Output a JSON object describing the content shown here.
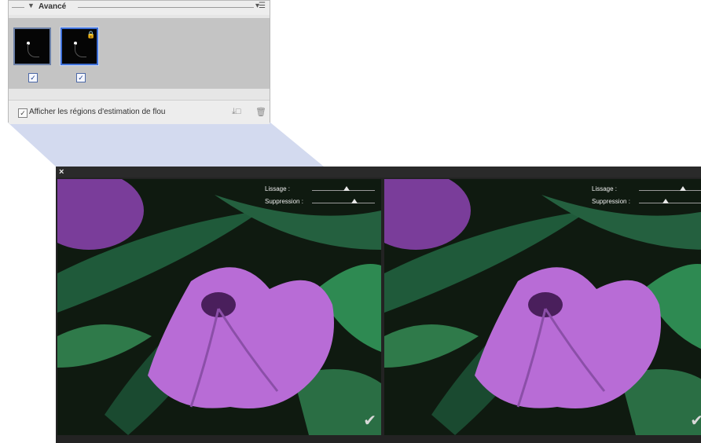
{
  "panel": {
    "title": "Avancé",
    "menu_icon": "panel-menu-icon",
    "thumbnails": [
      {
        "checked": true,
        "selected": false,
        "locked": false
      },
      {
        "checked": true,
        "selected": true,
        "locked": true
      }
    ],
    "check_glyph": "✓",
    "footer": {
      "checkbox_checked": true,
      "label": "Afficher les régions d'estimation de flou",
      "icons": [
        "add-region-icon",
        "trash-icon"
      ]
    }
  },
  "preview": {
    "close_glyph": "×",
    "panes": [
      {
        "smoothing_label": "Lissage :",
        "suppression_label": "Suppression :",
        "smoothing_value": 0.55,
        "suppression_value": 0.68
      },
      {
        "smoothing_label": "Lissage :",
        "suppression_label": "Suppression :",
        "smoothing_value": 0.7,
        "suppression_value": 0.42
      }
    ],
    "ok_glyph": "✔"
  },
  "colors": {
    "selection": "#3e6fd6",
    "connector": "#d3daef",
    "petal": "#b86cd6",
    "leaf": "#2f7a4a"
  }
}
